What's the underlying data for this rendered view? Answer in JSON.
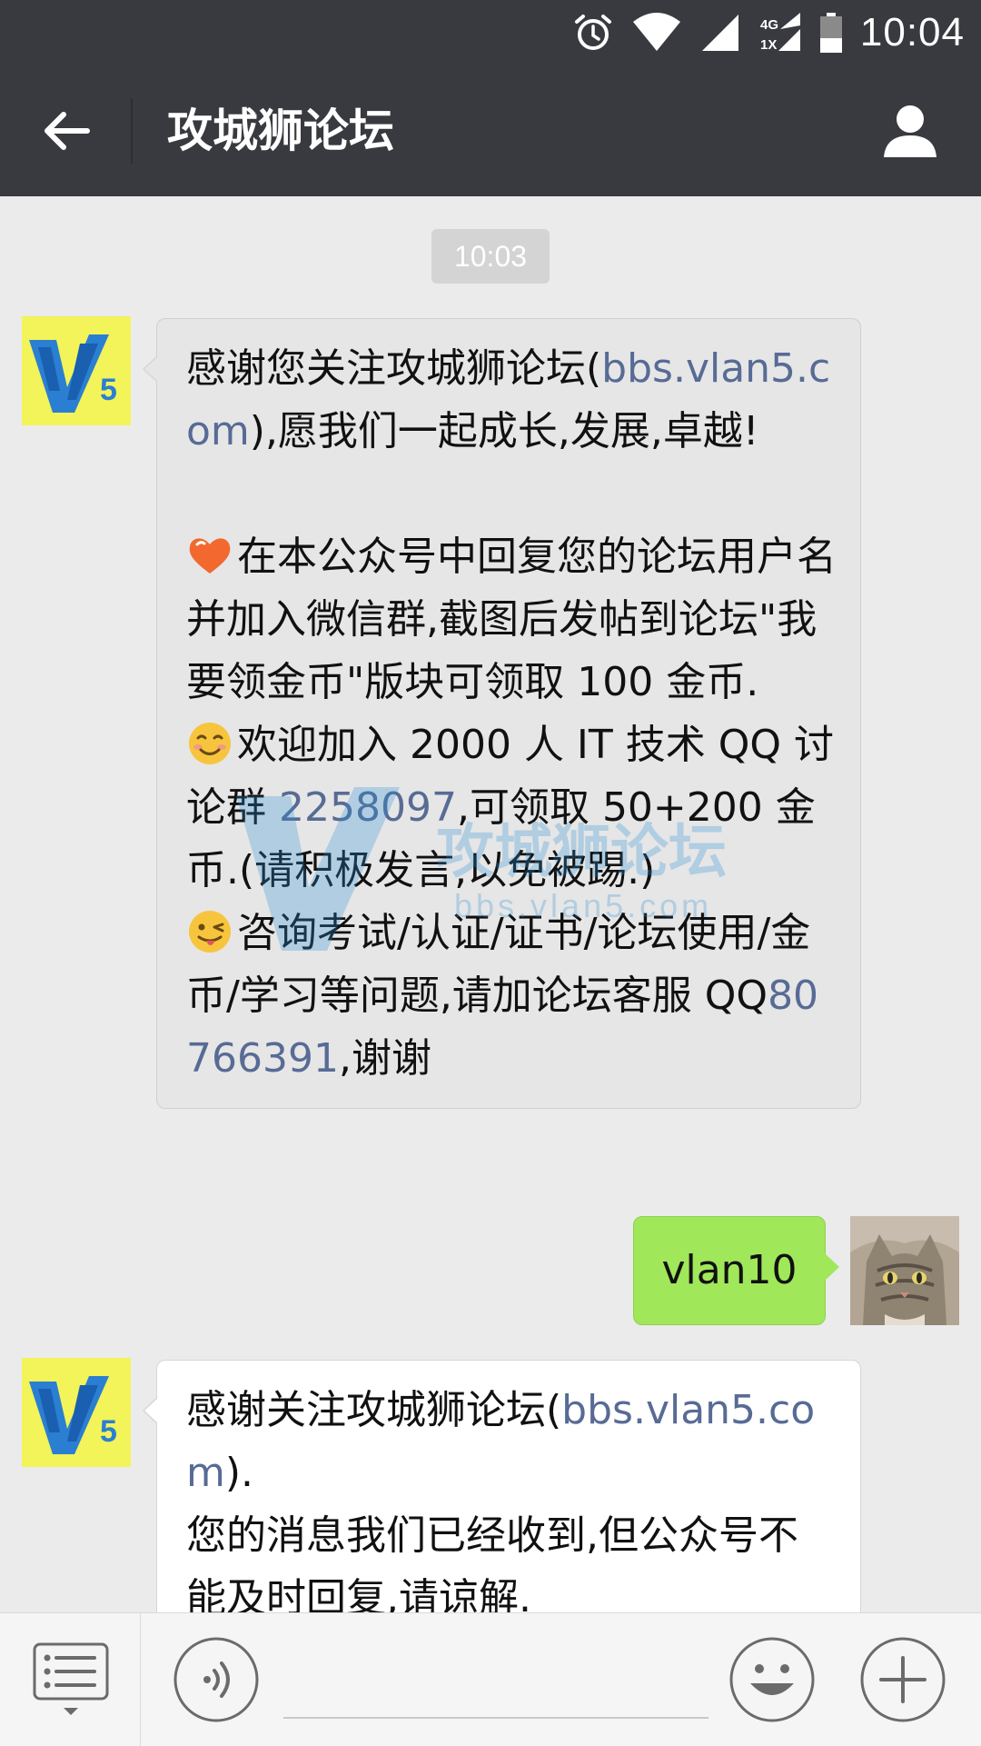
{
  "status_bar": {
    "time": "10:04",
    "network_top": "4G",
    "network_bottom": "1X"
  },
  "header": {
    "title": "攻城狮论坛"
  },
  "chat": {
    "timestamp": "10:03",
    "watermark": {
      "text": "攻城狮论坛",
      "sub": "bbs.vlan5.com"
    },
    "messages": [
      {
        "sender": "攻城狮论坛",
        "avatar_icon": "v5-logo-icon",
        "p1_a": "感谢您关注攻城狮论坛(",
        "p1_link": "bbs.vlan5.com",
        "p1_b": "),愿我们一起成长,发展,卓越!",
        "p2": "在本公众号中回复您的论坛用户名并加入微信群,截图后发帖到论坛\"我要领金币\"版块可领取 100 金币.",
        "p3_a": "欢迎加入 2000 人 IT 技术 QQ 讨论群 ",
        "p3_link": "2258097",
        "p3_b": ",可领取 50+200 金币.(请积极发言,以免被踢.)",
        "p4_a": "咨询考试/认证/证书/论坛使用/金币/学习等问题,请加论坛客服 QQ",
        "p4_link": "80766391",
        "p4_b": ",谢谢"
      },
      {
        "sender": "me",
        "avatar_icon": "cat-avatar-icon",
        "text": "vlan10"
      },
      {
        "sender": "攻城狮论坛",
        "avatar_icon": "v5-logo-icon",
        "p1_a": "感谢关注攻城狮论坛(",
        "p1_link": "bbs.vlan5.com",
        "p1_b": ").",
        "p2": "您的消息我们已经收到,但公众号不能及时回复,请谅解."
      }
    ]
  },
  "bottom_bar": {
    "input_placeholder": ""
  },
  "colors": {
    "header_bg": "#393a3f",
    "chat_bg": "#ebebeb",
    "link": "#576b95",
    "out_bubble": "#a0e75a"
  }
}
